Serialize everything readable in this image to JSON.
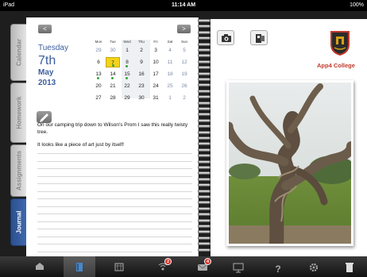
{
  "status_bar": {
    "device": "iPad",
    "time": "11:14 AM",
    "battery": "100%"
  },
  "side_tabs": [
    {
      "label": "Calendar",
      "active": false
    },
    {
      "label": "Homework",
      "active": false
    },
    {
      "label": "Assignments",
      "active": false
    },
    {
      "label": "Journal",
      "active": true
    }
  ],
  "date_panel": {
    "weekday": "Tuesday",
    "day": "7th",
    "month": "May",
    "year": "2013"
  },
  "calendar": {
    "prev_label": "<",
    "next_label": ">",
    "headers": [
      "Mon",
      "Tue",
      "Wed",
      "Thu",
      "Fri",
      "Sat",
      "Sun"
    ],
    "weeks": [
      [
        "29",
        "30",
        "1",
        "2",
        "3",
        "4",
        "5"
      ],
      [
        "6",
        "7",
        "8",
        "9",
        "10",
        "11",
        "12"
      ],
      [
        "13",
        "14",
        "15",
        "16",
        "17",
        "18",
        "19"
      ],
      [
        "20",
        "21",
        "22",
        "23",
        "24",
        "25",
        "26"
      ],
      [
        "27",
        "28",
        "29",
        "30",
        "31",
        "1",
        "2"
      ]
    ],
    "selected": "7"
  },
  "journal": {
    "entry_line1": "On our camping trip down to Wilson's Prom I saw this really twisty tree.",
    "entry_line2": "It looks like a piece of art just by itself!"
  },
  "right_page": {
    "college_name": "App4 College"
  },
  "tab_bar": {
    "items": [
      {
        "icon": "home-icon"
      },
      {
        "icon": "diary-icon"
      },
      {
        "icon": "calendar-grid-icon"
      },
      {
        "icon": "broadcast-icon",
        "badge": "2"
      },
      {
        "icon": "messages-icon",
        "badge": "4"
      },
      {
        "icon": "presentation-icon"
      },
      {
        "icon": "help-icon"
      },
      {
        "icon": "settings-icon"
      },
      {
        "icon": "trash-icon"
      }
    ]
  }
}
